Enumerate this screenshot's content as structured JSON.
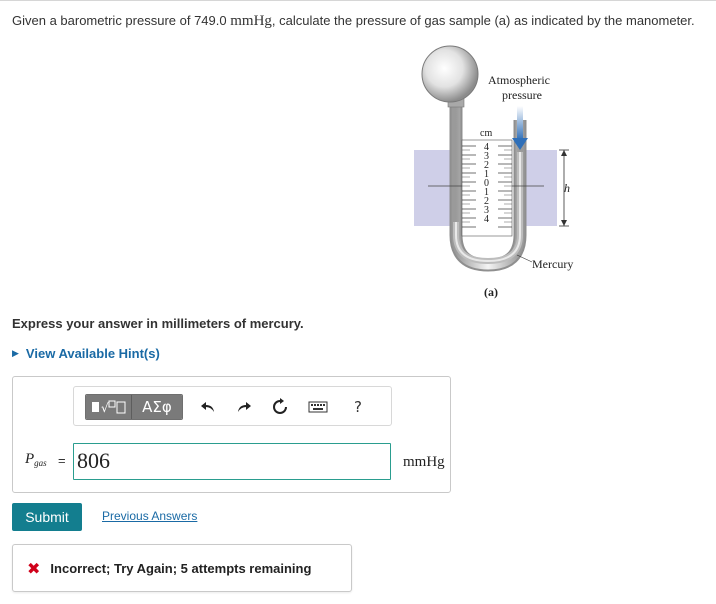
{
  "question": {
    "prefix": "Given a barometric pressure of 749.0",
    "unit": "mmHg",
    "suffix": ", calculate the pressure of gas sample (a) as indicated by the manometer."
  },
  "figure": {
    "atmospheric_line1": "Atmospheric",
    "atmospheric_line2": "pressure",
    "scale_unit": "cm",
    "scale_ticks": [
      "4",
      "3",
      "2",
      "1",
      "0",
      "1",
      "2",
      "3",
      "4"
    ],
    "h_label": "h",
    "mercury_label": "Mercury",
    "caption": "(a)"
  },
  "instruction": "Express your answer in millimeters of mercury.",
  "hint_link": "View Available Hint(s)",
  "toolbar": {
    "greek_label": "ΑΣφ",
    "help_label": "?",
    "icons": [
      "templates-icon",
      "greek-symbols-icon",
      "undo-icon",
      "redo-icon",
      "reset-icon",
      "keyboard-icon",
      "help-icon"
    ]
  },
  "answer": {
    "var_main": "P",
    "var_sub": "gas",
    "equals": "=",
    "value": "806",
    "unit": "mmHg"
  },
  "submit_label": "Submit",
  "previous_answers_label": "Previous Answers",
  "feedback": {
    "icon": "✖",
    "message": "Incorrect; Try Again; 5 attempts remaining",
    "color": "#d0021b"
  },
  "colors": {
    "accent": "#137e8f",
    "link": "#1a6aa5",
    "input_border": "#2a9d8f"
  }
}
